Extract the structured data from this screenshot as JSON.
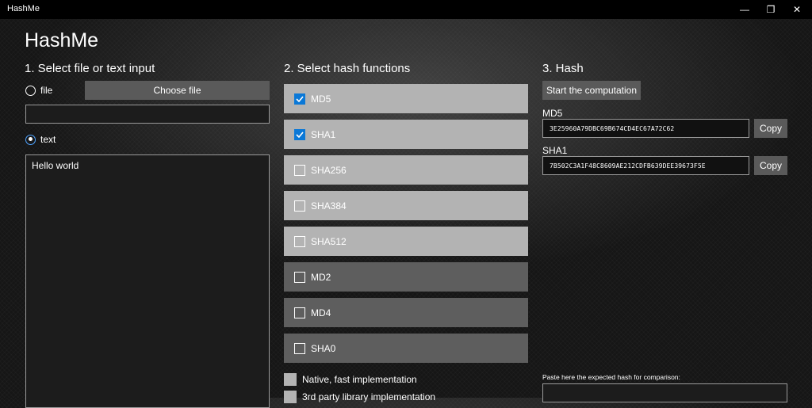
{
  "window": {
    "title": "HashMe",
    "minimize_glyph": "—",
    "maximize_glyph": "❐",
    "close_glyph": "✕"
  },
  "app_title": "HashMe",
  "input_section": {
    "heading": "1. Select file or text input",
    "file_radio_label": "file",
    "file_selected": false,
    "choose_file_label": "Choose file",
    "file_path_value": "",
    "text_radio_label": "text",
    "text_selected": true,
    "text_value": "Hello world"
  },
  "functions_section": {
    "heading": "2. Select hash functions",
    "functions": [
      {
        "label": "MD5",
        "checked": true
      },
      {
        "label": "SHA1",
        "checked": true
      },
      {
        "label": "SHA256",
        "checked": false
      },
      {
        "label": "SHA384",
        "checked": false
      },
      {
        "label": "SHA512",
        "checked": false
      },
      {
        "label": "MD2",
        "checked": false
      },
      {
        "label": "MD4",
        "checked": false
      },
      {
        "label": "SHA0",
        "checked": false
      }
    ],
    "implementations": [
      {
        "label": "Native, fast implementation"
      },
      {
        "label": "3rd party library implementation"
      }
    ]
  },
  "hash_section": {
    "heading": "3. Hash",
    "start_label": "Start the computation",
    "results": [
      {
        "name": "MD5",
        "value": "3E25960A79DBC69B674CD4EC67A72C62",
        "copy_label": "Copy"
      },
      {
        "name": "SHA1",
        "value": "7B502C3A1F48C8609AE212CDFB639DEE39673F5E",
        "copy_label": "Copy"
      }
    ],
    "compare_label": "Paste here the expected hash for comparison:",
    "compare_value": ""
  },
  "colors": {
    "accent": "#0a78d7",
    "item_enabled": "#b3b3b3",
    "item_disabled": "#5e5e5e",
    "button": "#5a5a5a"
  }
}
